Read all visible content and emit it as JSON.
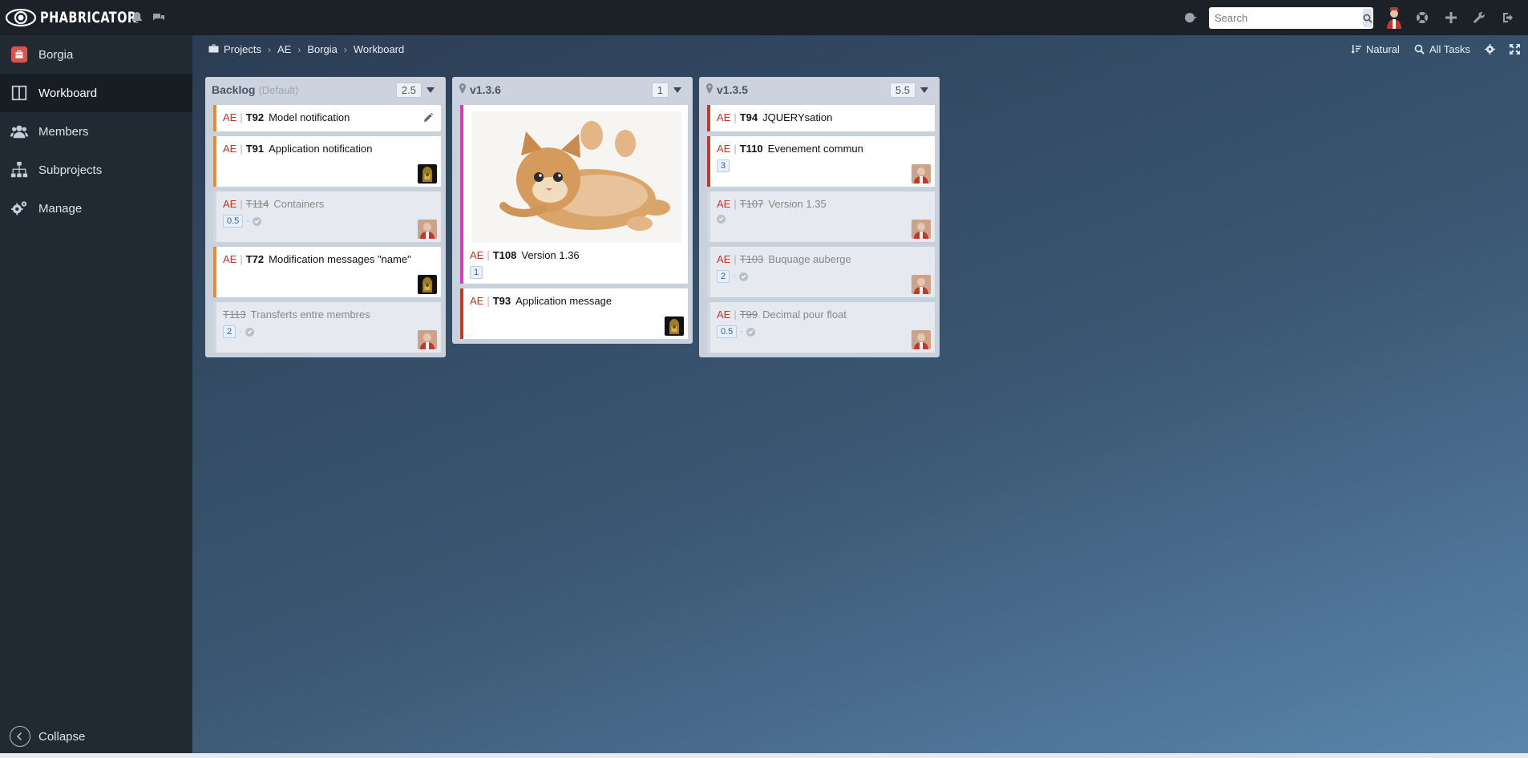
{
  "app": {
    "brand": "PHABRICATOR",
    "search_placeholder": "Search"
  },
  "sidebar": {
    "items": [
      {
        "label": "Borgia",
        "icon": "briefcase-icon",
        "active": false
      },
      {
        "label": "Workboard",
        "icon": "columns-icon",
        "active": true
      },
      {
        "label": "Members",
        "icon": "group-icon",
        "active": false
      },
      {
        "label": "Subprojects",
        "icon": "sitemap-icon",
        "active": false
      },
      {
        "label": "Manage",
        "icon": "gears-icon",
        "active": false
      }
    ],
    "collapse_label": "Collapse"
  },
  "breadcrumb": [
    "Projects",
    "AE",
    "Borgia",
    "Workboard"
  ],
  "board_actions": {
    "order_label": "Natural",
    "filter_label": "All Tasks"
  },
  "columns": [
    {
      "title": "Backlog",
      "subtitle": "(Default)",
      "points": "2.5",
      "cards": [
        {
          "project": "AE",
          "id": "T92",
          "title": "Model notification",
          "closed": false,
          "border": "orange"
        },
        {
          "project": "AE",
          "id": "T91",
          "title": "Application notification",
          "closed": false,
          "border": "orange"
        },
        {
          "project": "AE",
          "id": "T114",
          "title": "Containers",
          "closed": true,
          "points": "0.5"
        },
        {
          "project": "AE",
          "id": "T72",
          "title": "Modification messages \"name\"",
          "closed": false,
          "border": "orange"
        },
        {
          "project": "",
          "id": "T113",
          "title": "Transferts entre membres",
          "closed": true,
          "points": "2"
        }
      ]
    },
    {
      "title": "v1.3.6",
      "points": "1",
      "cards": [
        {
          "project": "AE",
          "id": "T108",
          "title": "Version 1.36",
          "closed": false,
          "border": "pink",
          "points": "1"
        },
        {
          "project": "AE",
          "id": "T93",
          "title": "Application message",
          "closed": false,
          "border": "red"
        }
      ]
    },
    {
      "title": "v1.3.5",
      "points": "5.5",
      "cards": [
        {
          "project": "AE",
          "id": "T94",
          "title": "JQUERYsation",
          "closed": false,
          "border": "red"
        },
        {
          "project": "AE",
          "id": "T110",
          "title": "Evenement commun",
          "closed": false,
          "border": "red",
          "points": "3"
        },
        {
          "project": "AE",
          "id": "T107",
          "title": "Version 1.35",
          "closed": true
        },
        {
          "project": "AE",
          "id": "T103",
          "title": "Buquage auberge",
          "closed": true,
          "points": "2"
        },
        {
          "project": "AE",
          "id": "T99",
          "title": "Decimal pour float",
          "closed": true,
          "points": "0.5"
        }
      ]
    }
  ],
  "colors": {
    "topbar": "#1c2127",
    "sidebar": "#212a33",
    "accent_red": "#c0392b",
    "accent_orange": "#e78a2b",
    "accent_pink": "#d43db3"
  }
}
